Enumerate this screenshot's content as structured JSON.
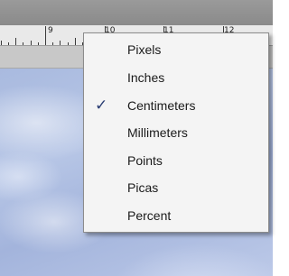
{
  "ruler": {
    "numbers": [
      "9",
      "10",
      "11",
      "12"
    ]
  },
  "units_menu": {
    "items": [
      {
        "label": "Pixels",
        "checked": false
      },
      {
        "label": "Inches",
        "checked": false
      },
      {
        "label": "Centimeters",
        "checked": true
      },
      {
        "label": "Millimeters",
        "checked": false
      },
      {
        "label": "Points",
        "checked": false
      },
      {
        "label": "Picas",
        "checked": false
      },
      {
        "label": "Percent",
        "checked": false
      }
    ],
    "check_glyph": "✓"
  },
  "colors": {
    "check_mark": "#2a3d73",
    "menu_background": "#f4f4f4",
    "sky": "#a9badf"
  }
}
